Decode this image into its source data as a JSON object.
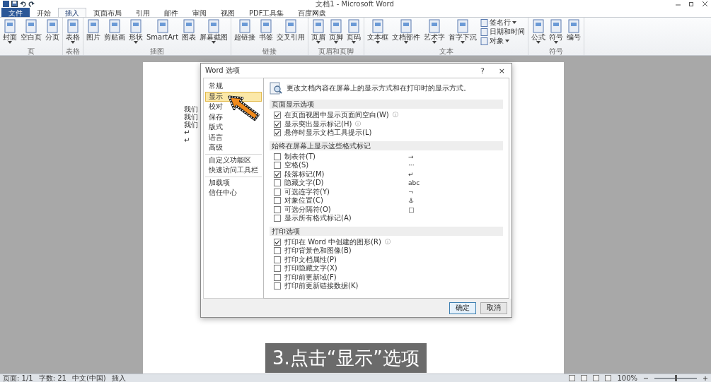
{
  "window": {
    "title": "文档1 - Microsoft Word"
  },
  "ribbon": {
    "tabs": [
      {
        "label": "文件",
        "selected": false,
        "kind": "file"
      },
      {
        "label": "开始",
        "selected": false,
        "kind": "tab"
      },
      {
        "label": "插入",
        "selected": true,
        "kind": "tab"
      },
      {
        "label": "页面布局",
        "selected": false,
        "kind": "tab"
      },
      {
        "label": "引用",
        "selected": false,
        "kind": "tab"
      },
      {
        "label": "邮件",
        "selected": false,
        "kind": "tab"
      },
      {
        "label": "审阅",
        "selected": false,
        "kind": "tab"
      },
      {
        "label": "视图",
        "selected": false,
        "kind": "tab"
      },
      {
        "label": "PDF工具集",
        "selected": false,
        "kind": "tab"
      },
      {
        "label": "百度网盘",
        "selected": false,
        "kind": "tab"
      }
    ],
    "groups": [
      {
        "label": "页",
        "buttons": [
          {
            "label": "封面",
            "kind": "large",
            "dropdown": true
          },
          {
            "label": "空白页",
            "kind": "large",
            "dropdown": false
          },
          {
            "label": "分页",
            "kind": "large",
            "dropdown": false
          }
        ]
      },
      {
        "label": "表格",
        "buttons": [
          {
            "label": "表格",
            "kind": "large",
            "dropdown": true
          }
        ]
      },
      {
        "label": "插图",
        "buttons": [
          {
            "label": "图片",
            "kind": "large",
            "dropdown": false
          },
          {
            "label": "剪贴画",
            "kind": "large",
            "dropdown": false
          },
          {
            "label": "形状",
            "kind": "large",
            "dropdown": true
          },
          {
            "label": "SmartArt",
            "kind": "large",
            "dropdown": false
          },
          {
            "label": "图表",
            "kind": "large",
            "dropdown": false
          },
          {
            "label": "屏幕截图",
            "kind": "large",
            "dropdown": true
          }
        ]
      },
      {
        "label": "链接",
        "buttons": [
          {
            "label": "超链接",
            "kind": "large",
            "dropdown": false
          },
          {
            "label": "书签",
            "kind": "large",
            "dropdown": false
          },
          {
            "label": "交叉引用",
            "kind": "large",
            "dropdown": false
          }
        ]
      },
      {
        "label": "页眉和页脚",
        "buttons": [
          {
            "label": "页眉",
            "kind": "large",
            "dropdown": true
          },
          {
            "label": "页脚",
            "kind": "large",
            "dropdown": true
          },
          {
            "label": "页码",
            "kind": "large",
            "dropdown": true
          }
        ]
      },
      {
        "label": "文本",
        "buttons": [
          {
            "label": "文本框",
            "kind": "large",
            "dropdown": true
          },
          {
            "label": "文档部件",
            "kind": "large",
            "dropdown": true
          },
          {
            "label": "艺术字",
            "kind": "large",
            "dropdown": true
          },
          {
            "label": "首字下沉",
            "kind": "large",
            "dropdown": true
          },
          {
            "label": "签名行",
            "kind": "small",
            "dropdown": true
          },
          {
            "label": "日期和时间",
            "kind": "small",
            "dropdown": false
          },
          {
            "label": "对象",
            "kind": "small",
            "dropdown": true
          }
        ]
      },
      {
        "label": "符号",
        "buttons": [
          {
            "label": "公式",
            "kind": "large",
            "dropdown": true
          },
          {
            "label": "符号",
            "kind": "large",
            "dropdown": true
          },
          {
            "label": "编号",
            "kind": "large",
            "dropdown": false
          }
        ]
      }
    ]
  },
  "document": {
    "paragraphs": [
      "我们",
      "我们",
      "我们",
      "↵",
      "↵"
    ]
  },
  "dialog": {
    "title": "Word 选项",
    "help": "?",
    "close": "×",
    "nav_groups": [
      {
        "items": [
          {
            "label": "常规",
            "selected": false
          },
          {
            "label": "显示",
            "selected": true
          },
          {
            "label": "校对",
            "selected": false
          },
          {
            "label": "保存",
            "selected": false
          },
          {
            "label": "版式",
            "selected": false
          },
          {
            "label": "语言",
            "selected": false
          },
          {
            "label": "高级",
            "selected": false
          }
        ]
      },
      {
        "items": [
          {
            "label": "自定义功能区",
            "selected": false
          },
          {
            "label": "快速访问工具栏",
            "selected": false
          }
        ]
      },
      {
        "items": [
          {
            "label": "加载项",
            "selected": false
          },
          {
            "label": "信任中心",
            "selected": false
          }
        ]
      }
    ],
    "description": "更改文档内容在屏幕上的显示方式和在打印时的显示方式。",
    "sections": [
      {
        "heading": "页面显示选项",
        "options": [
          {
            "label": "在页面视图中显示页面间空白(W)",
            "checked": true,
            "note": "ⓘ"
          },
          {
            "label": "显示突出显示标记(H)",
            "checked": true,
            "note": "ⓘ"
          },
          {
            "label": "悬停时显示文档工具提示(L)",
            "checked": true
          }
        ]
      },
      {
        "heading": "始终在屏幕上显示这些格式标记",
        "options": [
          {
            "label": "制表符(T)",
            "checked": false,
            "symbol": "→"
          },
          {
            "label": "空格(S)",
            "checked": false,
            "symbol": "···"
          },
          {
            "label": "段落标记(M)",
            "checked": true,
            "symbol": "↵"
          },
          {
            "label": "隐藏文字(D)",
            "checked": false,
            "symbol": "abc"
          },
          {
            "label": "可选连字符(Y)",
            "checked": false,
            "symbol": "¬"
          },
          {
            "label": "对象位置(C)",
            "checked": false,
            "symbol": "⚓"
          },
          {
            "label": "可选分隔符(O)",
            "checked": false,
            "symbol": "□"
          },
          {
            "label": "显示所有格式标记(A)",
            "checked": false
          }
        ]
      },
      {
        "heading": "打印选项",
        "options": [
          {
            "label": "打印在 Word 中创建的图形(R)",
            "checked": true,
            "note": "ⓘ"
          },
          {
            "label": "打印背景色和图像(B)",
            "checked": false
          },
          {
            "label": "打印文档属性(P)",
            "checked": false
          },
          {
            "label": "打印隐藏文字(X)",
            "checked": false
          },
          {
            "label": "打印前更新域(F)",
            "checked": false
          },
          {
            "label": "打印前更新链接数据(K)",
            "checked": false
          }
        ]
      }
    ],
    "buttons": [
      {
        "label": "确定",
        "default": true
      },
      {
        "label": "取消",
        "default": false
      }
    ]
  },
  "caption": "3.点击“显示”选项",
  "status_bar": {
    "items": [
      "页面: 1/1",
      "字数: 21",
      "中文(中国)",
      "插入"
    ],
    "zoom": "100%",
    "zoom_slider": {
      "level": 0.5
    }
  }
}
